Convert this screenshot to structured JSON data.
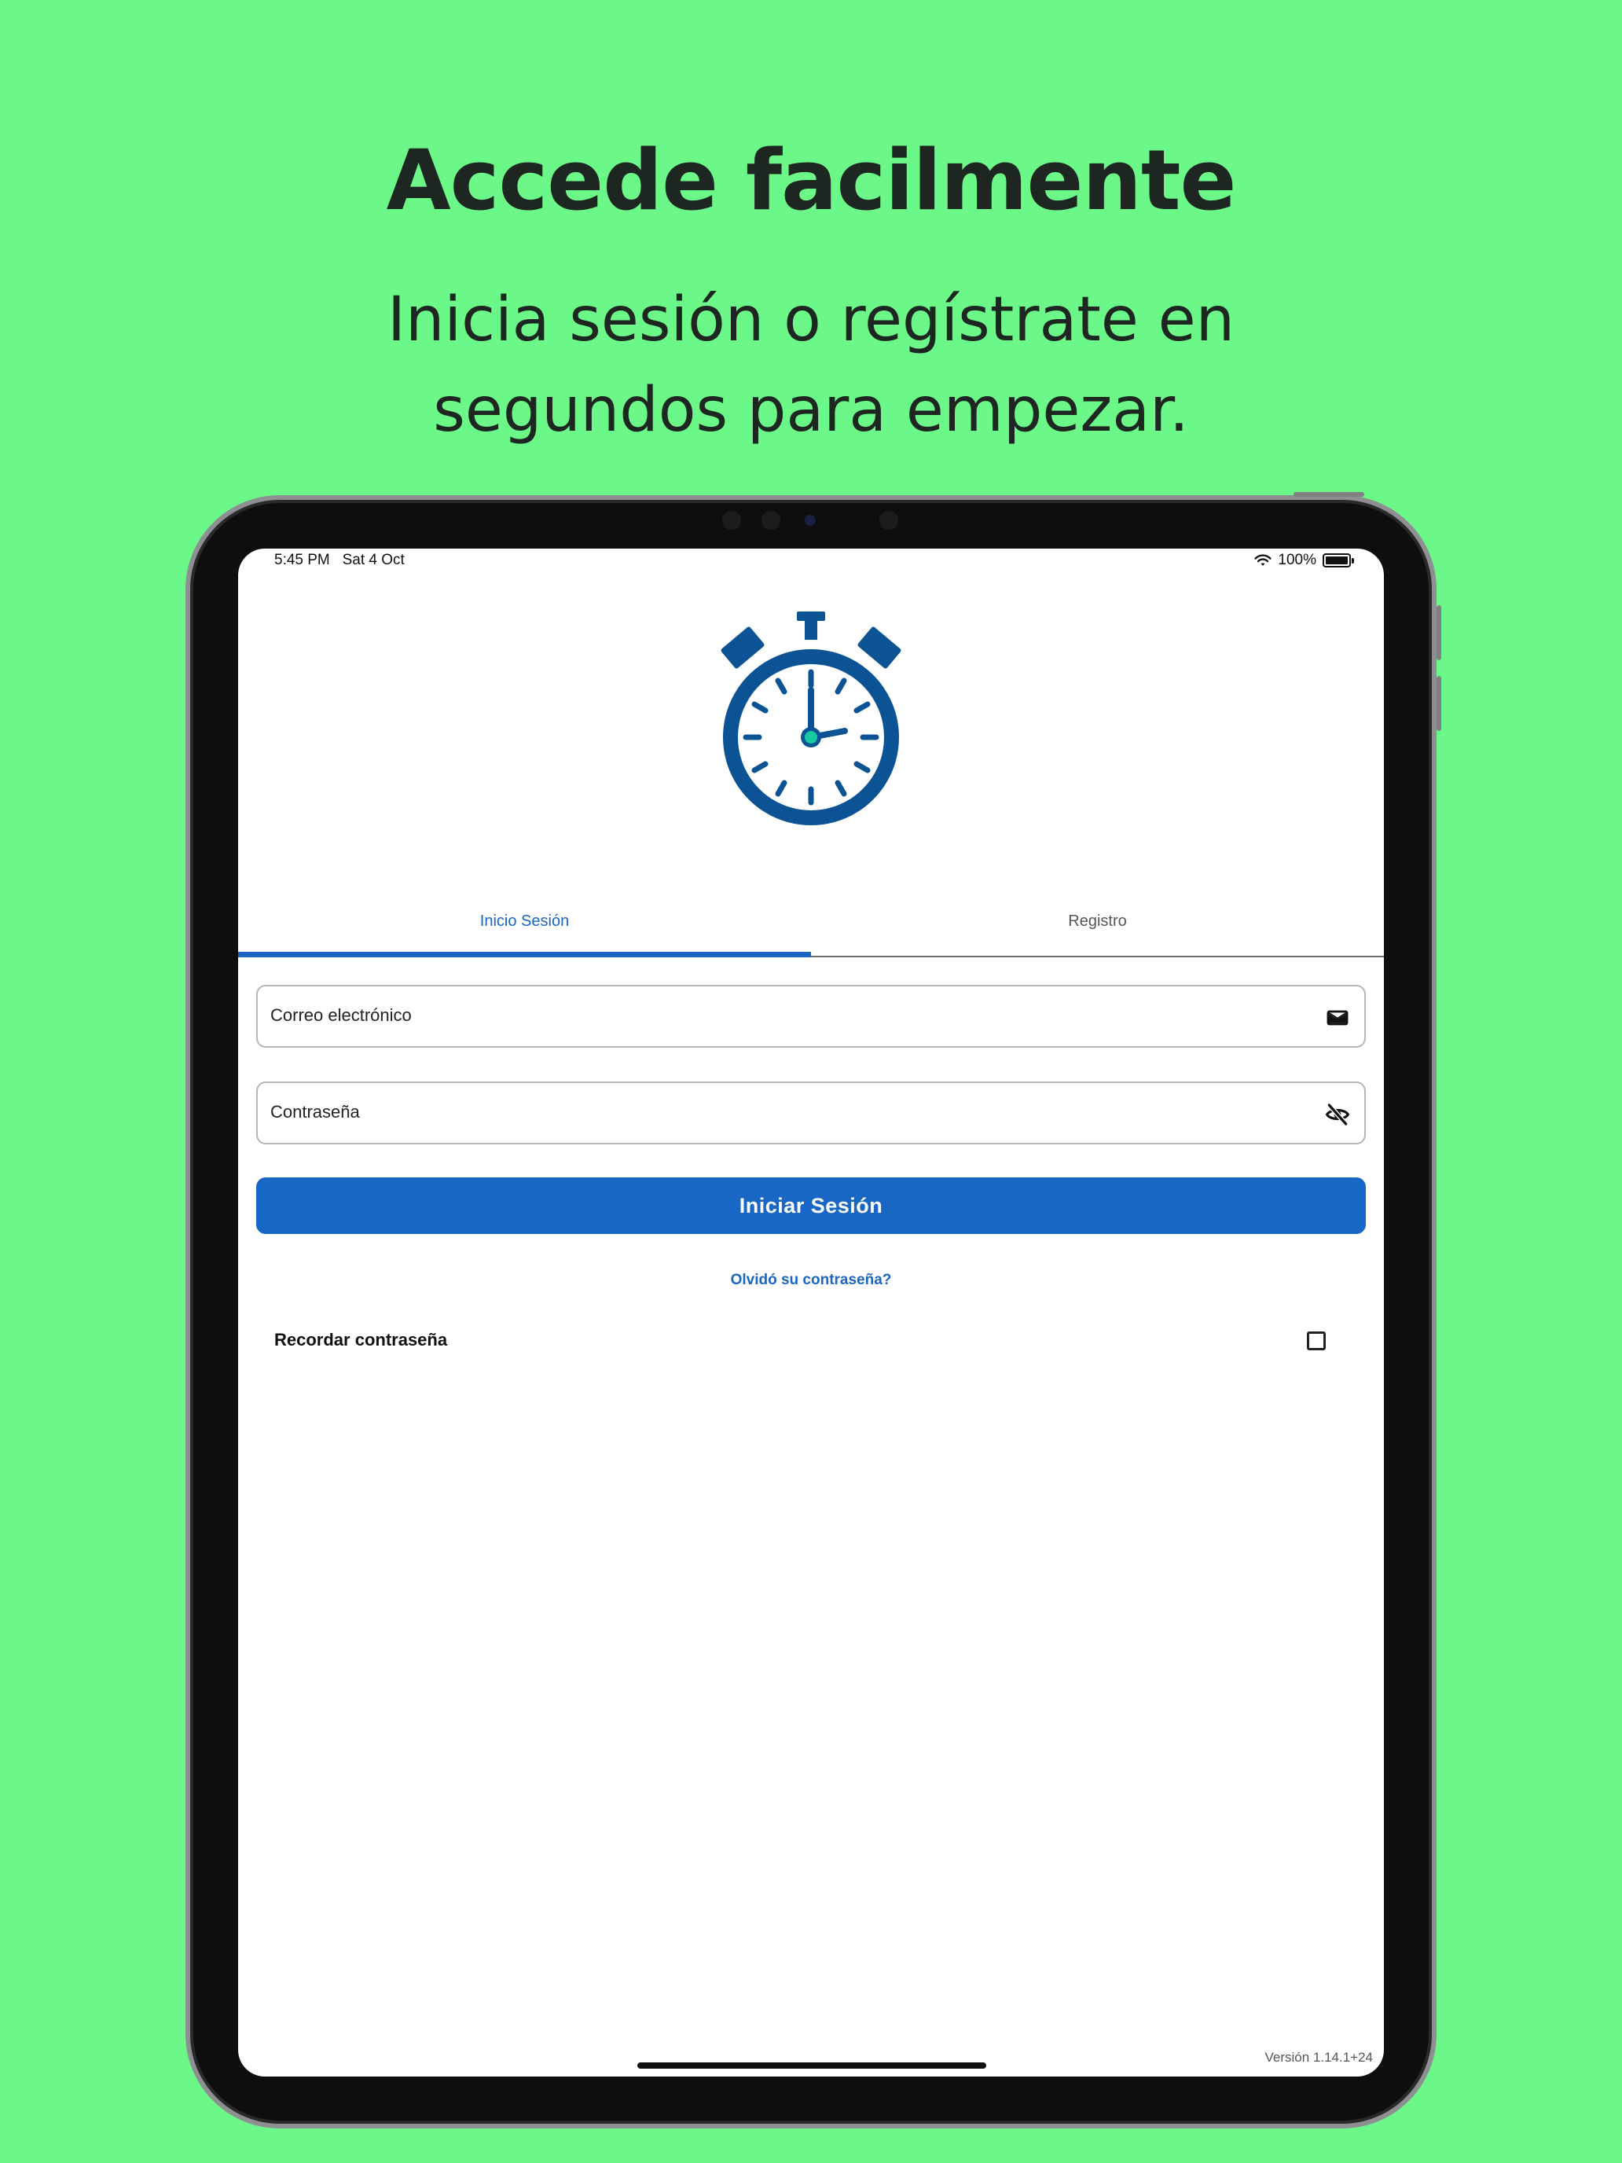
{
  "promo": {
    "headline": "Accede facilmente",
    "subline_1": "Inicia sesión o regístrate en",
    "subline_2": "segundos para empezar."
  },
  "status_bar": {
    "time": "5:45 PM",
    "date": "Sat 4 Oct",
    "battery": "100%"
  },
  "tabs": [
    {
      "label": "Inicio Sesión",
      "active": true
    },
    {
      "label": "Registro",
      "active": false
    }
  ],
  "form": {
    "email_label": "Correo electrónico",
    "password_label": "Contraseña",
    "submit_label": "Iniciar Sesión",
    "forgot_label": "Olvidó su contraseña?",
    "remember_label": "Recordar contraseña"
  },
  "footer": {
    "version": "Versión 1.14.1+24"
  },
  "icons": {
    "logo": "stopwatch-icon",
    "email": "mail-icon",
    "password": "eye-off-icon",
    "wifi": "wifi-icon",
    "battery": "battery-icon"
  },
  "colors": {
    "background": "#6bf888",
    "accent": "#1a66c2",
    "logo": "#0b5394",
    "logo_center": "#17c9a0"
  }
}
